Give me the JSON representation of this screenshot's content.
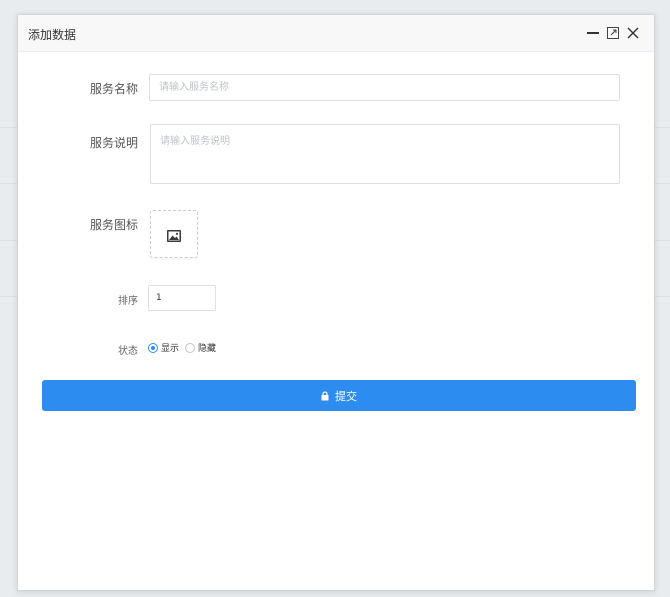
{
  "dialog": {
    "title": "添加数据",
    "controls": [
      "minimize-icon",
      "maximize-icon",
      "close-icon"
    ]
  },
  "form": {
    "name": {
      "label": "服务名称",
      "placeholder": "请输入服务名称",
      "value": ""
    },
    "description": {
      "label": "服务说明",
      "placeholder": "请输入服务说明",
      "value": ""
    },
    "icon": {
      "label": "服务图标",
      "icon": "image-icon"
    },
    "sort": {
      "label": "排序",
      "value": "1"
    },
    "status": {
      "label": "状态",
      "options": [
        {
          "label": "显示",
          "checked": true
        },
        {
          "label": "隐藏",
          "checked": false
        }
      ]
    }
  },
  "submit": {
    "label": "提交",
    "icon": "lock-icon"
  },
  "colors": {
    "accent": "#2d8cf0",
    "header_bg": "#f8f8f8"
  }
}
